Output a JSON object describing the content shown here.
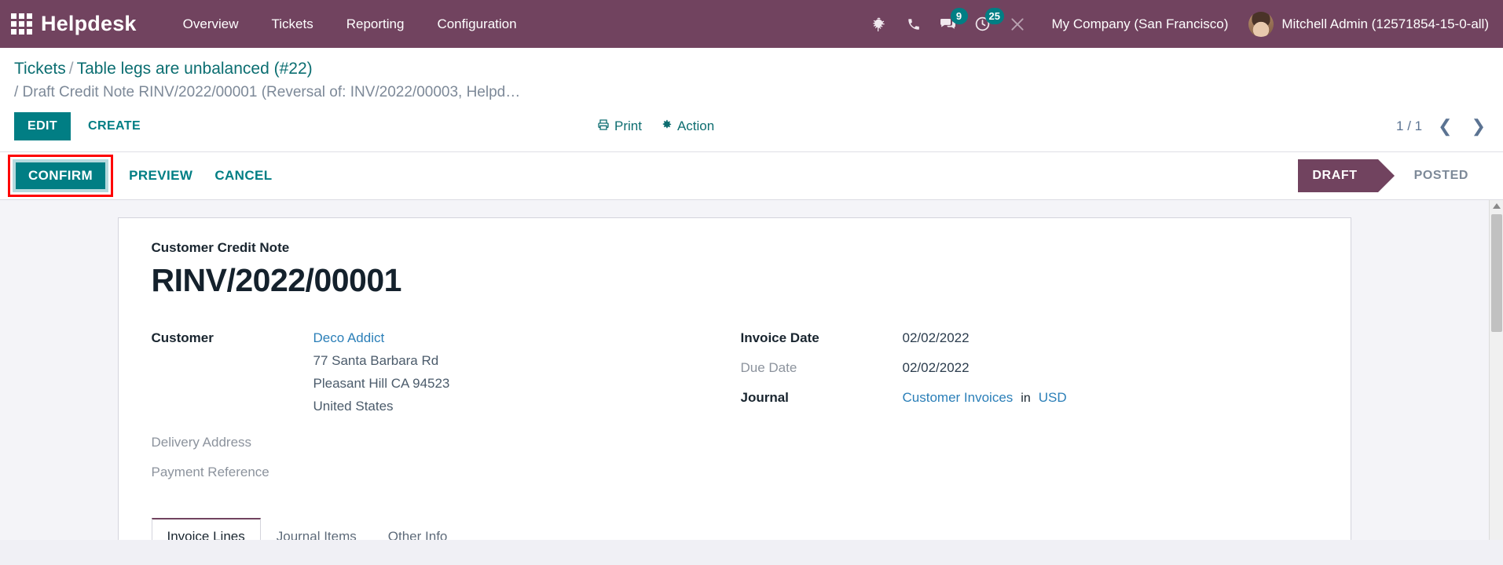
{
  "navbar": {
    "apps_icon": "apps-grid-icon",
    "brand": "Helpdesk",
    "menus": [
      {
        "label": "Overview"
      },
      {
        "label": "Tickets"
      },
      {
        "label": "Reporting"
      },
      {
        "label": "Configuration"
      }
    ],
    "sys_icons": [
      {
        "name": "bug-icon",
        "badge": null
      },
      {
        "name": "phone-icon",
        "badge": null
      },
      {
        "name": "messages-icon",
        "badge": "9"
      },
      {
        "name": "activity-clock-icon",
        "badge": "25"
      },
      {
        "name": "tools-wrench-icon",
        "badge": null
      }
    ],
    "badges": {
      "messages": "9",
      "activities": "25"
    },
    "company": "My Company (San Francisco)",
    "user": "Mitchell Admin (12571854-15-0-all)",
    "bg_color": "#71435f"
  },
  "breadcrumb": {
    "root": "Tickets",
    "separator": "/",
    "ticket": "Table legs are unbalanced (#22)",
    "second_line": "/ Draft Credit Note RINV/2022/00001 (Reversal of: INV/2022/00003, Helpd…"
  },
  "control_panel": {
    "edit_label": "EDIT",
    "create_label": "CREATE",
    "print_label": "Print",
    "print_icon": "printer-icon",
    "action_label": "Action",
    "action_icon": "gear-icon",
    "pager": "1 / 1",
    "prev_icon": "chevron-left-icon",
    "next_icon": "chevron-right-icon"
  },
  "statusbar": {
    "confirm_label": "CONFIRM",
    "preview_label": "PREVIEW",
    "cancel_label": "CANCEL",
    "confirm_highlight_color": "#fe0000",
    "stages": [
      {
        "label": "DRAFT",
        "active": true
      },
      {
        "label": "POSTED",
        "active": false
      }
    ]
  },
  "form": {
    "doc_type": "Customer Credit Note",
    "doc_number": "RINV/2022/00001",
    "left_fields": {
      "customer_label": "Customer",
      "customer_name": "Deco Addict",
      "customer_address": [
        "77 Santa Barbara Rd",
        "Pleasant Hill CA 94523",
        "United States"
      ],
      "delivery_address_label": "Delivery Address",
      "delivery_address_value": "",
      "payment_reference_label": "Payment Reference",
      "payment_reference_value": ""
    },
    "right_fields": {
      "invoice_date_label": "Invoice Date",
      "invoice_date_value": "02/02/2022",
      "due_date_label": "Due Date",
      "due_date_value": "02/02/2022",
      "journal_label": "Journal",
      "journal_value": "Customer Invoices",
      "journal_in_word": "in",
      "currency_value": "USD"
    },
    "tabs": [
      {
        "label": "Invoice Lines",
        "active": true
      },
      {
        "label": "Journal Items",
        "active": false
      },
      {
        "label": "Other Info",
        "active": false
      }
    ]
  }
}
